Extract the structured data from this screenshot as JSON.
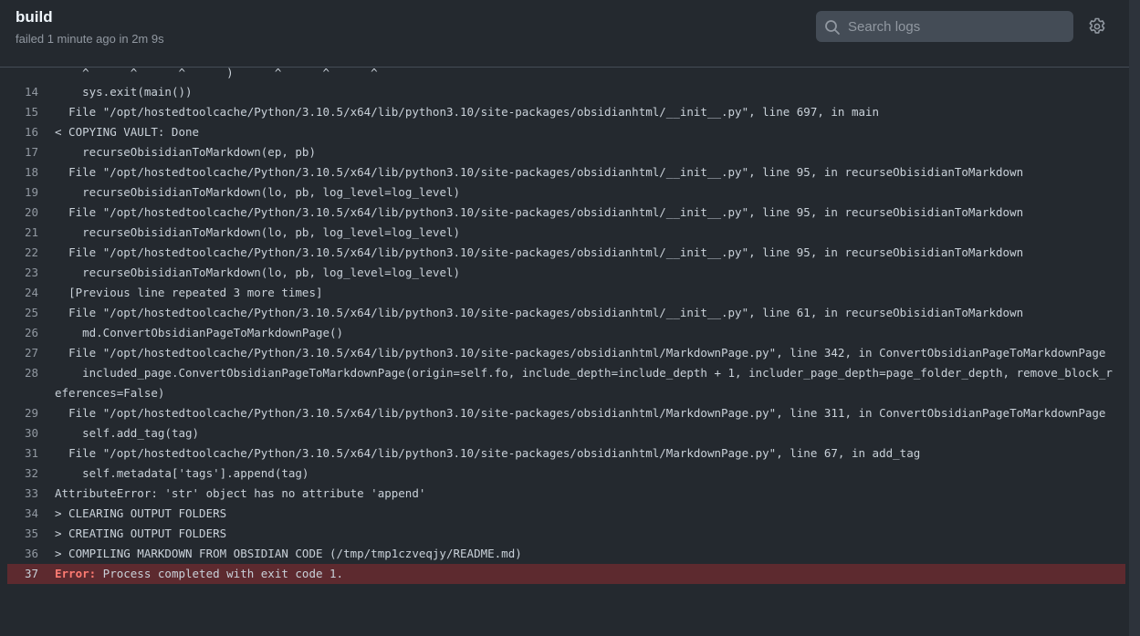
{
  "header": {
    "title": "build",
    "subtitle": "failed 1 minute ago in 2m 9s",
    "search_placeholder": "Search logs",
    "settings_icon": "gear-icon",
    "search_icon": "search-icon"
  },
  "log": {
    "clipped_text": "    ^      ^      ^      )      ^      ^      ^",
    "lines": [
      {
        "num": "14",
        "text": "    sys.exit(main())"
      },
      {
        "num": "15",
        "text": "  File \"/opt/hostedtoolcache/Python/3.10.5/x64/lib/python3.10/site-packages/obsidianhtml/__init__.py\", line 697, in main"
      },
      {
        "num": "16",
        "text": "< COPYING VAULT: Done"
      },
      {
        "num": "17",
        "text": "    recurseObisidianToMarkdown(ep, pb)"
      },
      {
        "num": "18",
        "text": "  File \"/opt/hostedtoolcache/Python/3.10.5/x64/lib/python3.10/site-packages/obsidianhtml/__init__.py\", line 95, in recurseObisidianToMarkdown"
      },
      {
        "num": "19",
        "text": "    recurseObisidianToMarkdown(lo, pb, log_level=log_level)"
      },
      {
        "num": "20",
        "text": "  File \"/opt/hostedtoolcache/Python/3.10.5/x64/lib/python3.10/site-packages/obsidianhtml/__init__.py\", line 95, in recurseObisidianToMarkdown"
      },
      {
        "num": "21",
        "text": "    recurseObisidianToMarkdown(lo, pb, log_level=log_level)"
      },
      {
        "num": "22",
        "text": "  File \"/opt/hostedtoolcache/Python/3.10.5/x64/lib/python3.10/site-packages/obsidianhtml/__init__.py\", line 95, in recurseObisidianToMarkdown"
      },
      {
        "num": "23",
        "text": "    recurseObisidianToMarkdown(lo, pb, log_level=log_level)"
      },
      {
        "num": "24",
        "text": "  [Previous line repeated 3 more times]"
      },
      {
        "num": "25",
        "text": "  File \"/opt/hostedtoolcache/Python/3.10.5/x64/lib/python3.10/site-packages/obsidianhtml/__init__.py\", line 61, in recurseObisidianToMarkdown"
      },
      {
        "num": "26",
        "text": "    md.ConvertObsidianPageToMarkdownPage()"
      },
      {
        "num": "27",
        "text": "  File \"/opt/hostedtoolcache/Python/3.10.5/x64/lib/python3.10/site-packages/obsidianhtml/MarkdownPage.py\", line 342, in ConvertObsidianPageToMarkdownPage"
      },
      {
        "num": "28",
        "text": "    included_page.ConvertObsidianPageToMarkdownPage(origin=self.fo, include_depth=include_depth + 1, includer_page_depth=page_folder_depth, remove_block_references=False)"
      },
      {
        "num": "29",
        "text": "  File \"/opt/hostedtoolcache/Python/3.10.5/x64/lib/python3.10/site-packages/obsidianhtml/MarkdownPage.py\", line 311, in ConvertObsidianPageToMarkdownPage"
      },
      {
        "num": "30",
        "text": "    self.add_tag(tag)"
      },
      {
        "num": "31",
        "text": "  File \"/opt/hostedtoolcache/Python/3.10.5/x64/lib/python3.10/site-packages/obsidianhtml/MarkdownPage.py\", line 67, in add_tag"
      },
      {
        "num": "32",
        "text": "    self.metadata['tags'].append(tag)"
      },
      {
        "num": "33",
        "text": "AttributeError: 'str' object has no attribute 'append'"
      },
      {
        "num": "34",
        "text": "> CLEARING OUTPUT FOLDERS"
      },
      {
        "num": "35",
        "text": "> CREATING OUTPUT FOLDERS"
      },
      {
        "num": "36",
        "text": "> COMPILING MARKDOWN FROM OBSIDIAN CODE (/tmp/tmp1czveqjy/README.md)"
      }
    ],
    "error_line": {
      "num": "37",
      "label": "Error:",
      "text": " Process completed with exit code 1."
    }
  },
  "colors": {
    "background": "#24292f",
    "error_background": "#5d2a2f",
    "error_label": "#ff7b72"
  }
}
